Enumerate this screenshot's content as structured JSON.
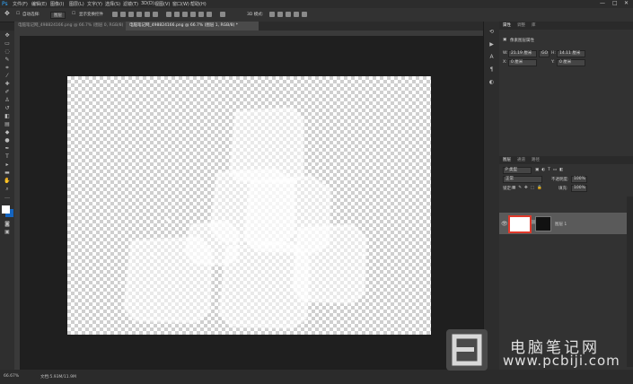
{
  "menubar": {
    "items": [
      "文件(F)",
      "编辑(E)",
      "图像(I)",
      "图层(L)",
      "文字(Y)",
      "选择(S)",
      "滤镜(T)",
      "3D(D)",
      "视图(V)",
      "窗口(W)",
      "帮助(H)"
    ],
    "window_controls": [
      "—",
      "□",
      "✕"
    ]
  },
  "options_bar": {
    "auto_select_label": "自动选择:",
    "auto_select_value": "图层",
    "show_transform_label": "显示变换控件"
  },
  "tabs": [
    {
      "label": "电脑笔记网_498824166.png @ 66.7% (图层 0, RGB/8)",
      "active": false
    },
    {
      "label": "电脑笔记网_498824166.png @ 66.7% (图层 1, RGB/8) *",
      "active": true
    }
  ],
  "status": {
    "zoom": "66.67%",
    "doc_info": "文档:5.93M/11.9M"
  },
  "properties": {
    "tabs": [
      "属性",
      "调整",
      "库"
    ],
    "title": "像素图层属性",
    "w_label": "W:",
    "w_value": "21.19 厘米",
    "go_label": "GO",
    "h_label": "H:",
    "h_value": "14.11 厘米",
    "x_label": "X:",
    "x_value": "0 厘米",
    "y_label": "Y:",
    "y_value": "0 厘米"
  },
  "layers": {
    "tabs": [
      "图层",
      "通道",
      "路径"
    ],
    "kind_label": "P 类型",
    "blend_mode": "正常",
    "opacity_label": "不透明度:",
    "opacity_value": "100%",
    "lock_label": "锁定:",
    "fill_label": "填充:",
    "fill_value": "100%",
    "layer_name": "图层 1"
  },
  "watermark": {
    "cn": "电脑笔记网",
    "url": "www.pcbiji.com"
  },
  "icons": {
    "move": "move-icon",
    "marquee": "marquee-icon",
    "lasso": "lasso-icon",
    "eye": "eye-icon",
    "brush": "brush-icon"
  }
}
